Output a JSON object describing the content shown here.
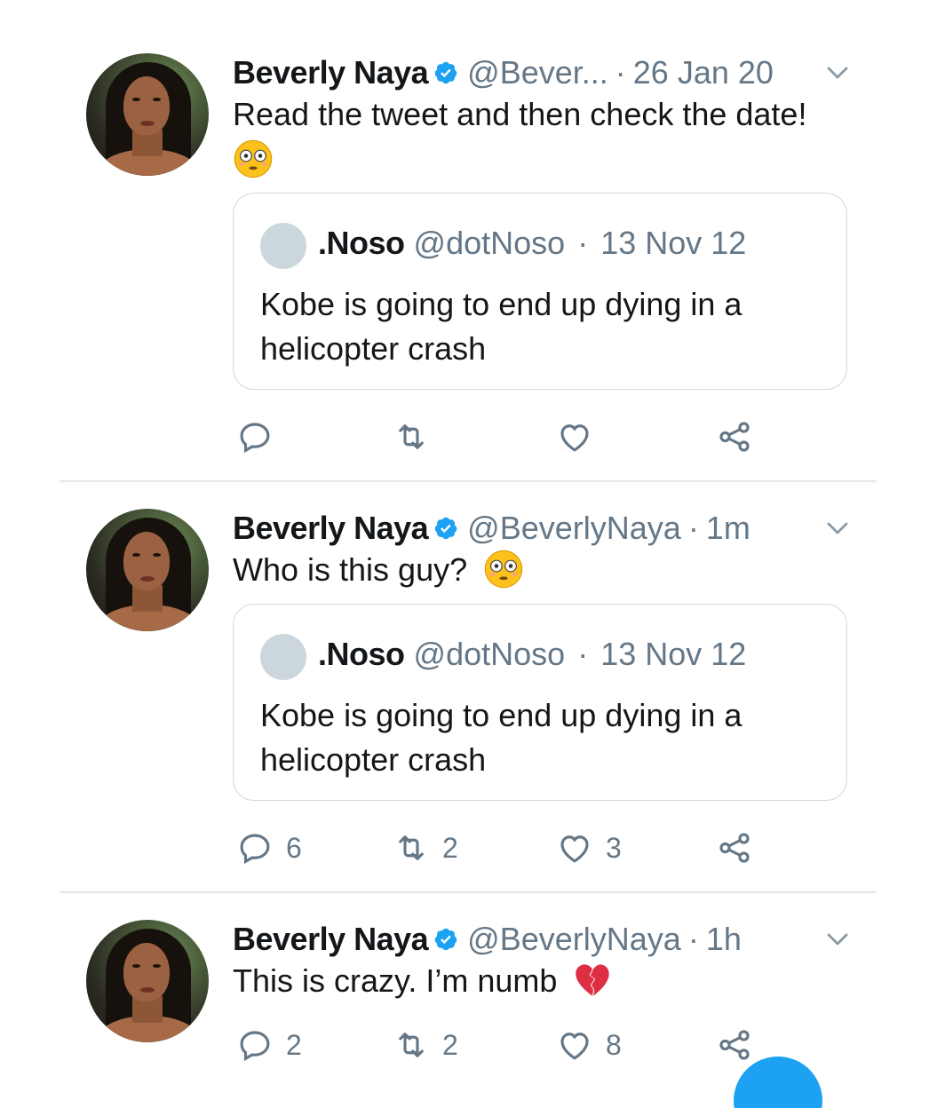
{
  "colors": {
    "accent": "#1da1f2",
    "secondary_text": "#657786",
    "border": "#cfd9de"
  },
  "tweets": [
    {
      "author_name": "Beverly Naya",
      "author_handle": "@Bever...",
      "time": "26 Jan 20",
      "text": "Read the tweet and then check the date!",
      "emoji": "flushed-face-emoji",
      "quote": {
        "name": ".Noso",
        "handle": "@dotNoso",
        "date": "13 Nov 12",
        "text": "Kobe is going to end up dying in a helicopter crash"
      },
      "counts": {
        "reply": "",
        "retweet": "",
        "like": ""
      }
    },
    {
      "author_name": "Beverly Naya",
      "author_handle": "@BeverlyNaya",
      "time": "1m",
      "text": "Who is this guy?",
      "emoji": "flushed-face-emoji",
      "quote": {
        "name": ".Noso",
        "handle": "@dotNoso",
        "date": "13 Nov 12",
        "text": "Kobe is going to end up dying in a helicopter crash"
      },
      "counts": {
        "reply": "6",
        "retweet": "2",
        "like": "3"
      }
    },
    {
      "author_name": "Beverly Naya",
      "author_handle": "@BeverlyNaya",
      "time": "1h",
      "text": "This is crazy. I’m numb",
      "emoji": "broken-heart-emoji",
      "counts": {
        "reply": "2",
        "retweet": "2",
        "like": "8"
      }
    }
  ],
  "separator": "·"
}
